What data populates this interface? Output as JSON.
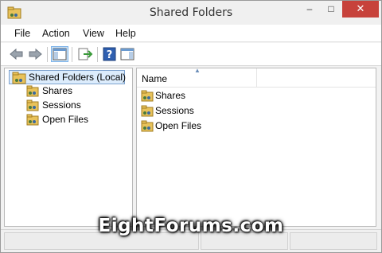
{
  "window": {
    "title": "Shared Folders",
    "minimize": "–",
    "maximize": "□",
    "close": "✕"
  },
  "menu": [
    "File",
    "Action",
    "View",
    "Help"
  ],
  "tree": {
    "root": "Shared Folders (Local)",
    "children": [
      "Shares",
      "Sessions",
      "Open Files"
    ]
  },
  "list": {
    "column_name": "Name",
    "sort_indicator": "▲",
    "items": [
      "Shares",
      "Sessions",
      "Open Files"
    ]
  },
  "watermark": "EightForums.com",
  "colors": {
    "close_button": "#c7423b",
    "selection": "#dcecfc",
    "folder": "#e2b84a"
  }
}
